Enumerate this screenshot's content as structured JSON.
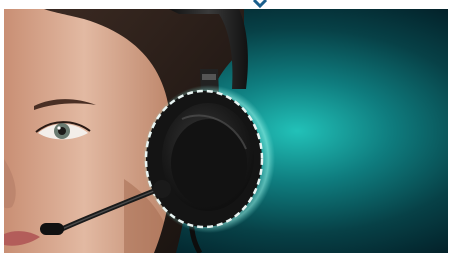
{
  "image": {
    "subject": "woman-wearing-headset",
    "icon": "headset-icon",
    "colors": {
      "background_teal": "#1fb3ad",
      "background_dark": "#03242b",
      "headset": "#1c1c1c",
      "ring_light": "#e8f4f2",
      "skin": "#d9b098"
    }
  }
}
